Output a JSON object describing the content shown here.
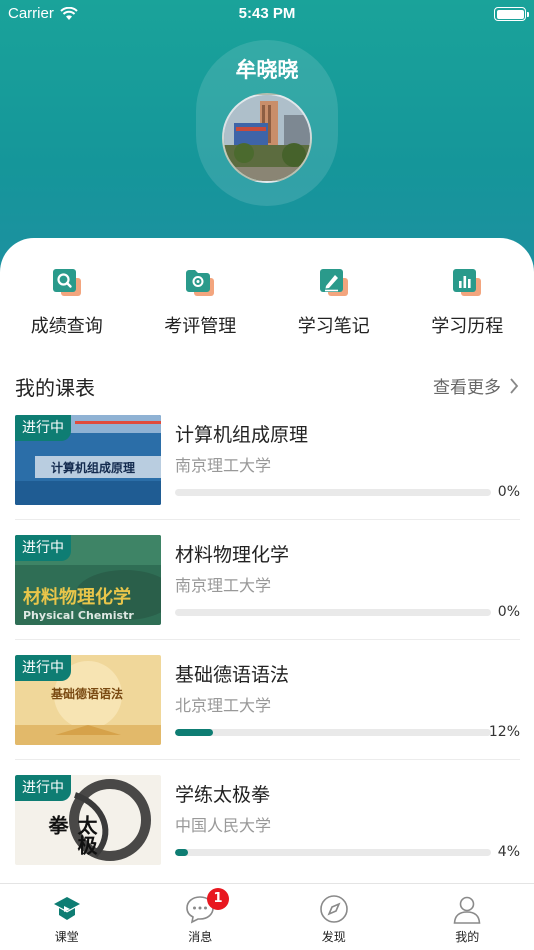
{
  "status_bar": {
    "carrier": "Carrier",
    "time": "5:43 PM"
  },
  "profile": {
    "name": "牟晓晓"
  },
  "quick_actions": [
    {
      "label": "成绩查询",
      "icon": "grade-search-icon"
    },
    {
      "label": "考评管理",
      "icon": "evaluation-folder-icon"
    },
    {
      "label": "学习笔记",
      "icon": "notes-edit-icon"
    },
    {
      "label": "学习历程",
      "icon": "history-chart-icon"
    }
  ],
  "schedule": {
    "title": "我的课表",
    "more_label": "查看更多",
    "courses": [
      {
        "status": "进行中",
        "title": "计算机组成原理",
        "school": "南京理工大学",
        "progress": 0,
        "progress_label": "0%",
        "thumb_text": "计算机组成原理"
      },
      {
        "status": "进行中",
        "title": "材料物理化学",
        "school": "南京理工大学",
        "progress": 0,
        "progress_label": "0%",
        "thumb_text": "材料物理化学",
        "thumb_sub": "Physical Chemistr"
      },
      {
        "status": "进行中",
        "title": "基础德语语法",
        "school": "北京理工大学",
        "progress": 12,
        "progress_label": "12%",
        "thumb_text": "基础德语语法"
      },
      {
        "status": "进行中",
        "title": "学练太极拳",
        "school": "中国人民大学",
        "progress": 4,
        "progress_label": "4%",
        "thumb_text": "太极拳"
      }
    ]
  },
  "tabbar": {
    "active_index": 0,
    "tabs": [
      {
        "label": "课堂",
        "icon": "classroom-icon"
      },
      {
        "label": "消息",
        "icon": "message-icon",
        "badge": "1"
      },
      {
        "label": "发现",
        "icon": "compass-icon"
      },
      {
        "label": "我的",
        "icon": "profile-icon"
      }
    ]
  },
  "colors": {
    "accent": "#0e7d73",
    "header_top": "#1aa39a",
    "header_bottom": "#1f8fa2",
    "badge": "#e8171f"
  }
}
